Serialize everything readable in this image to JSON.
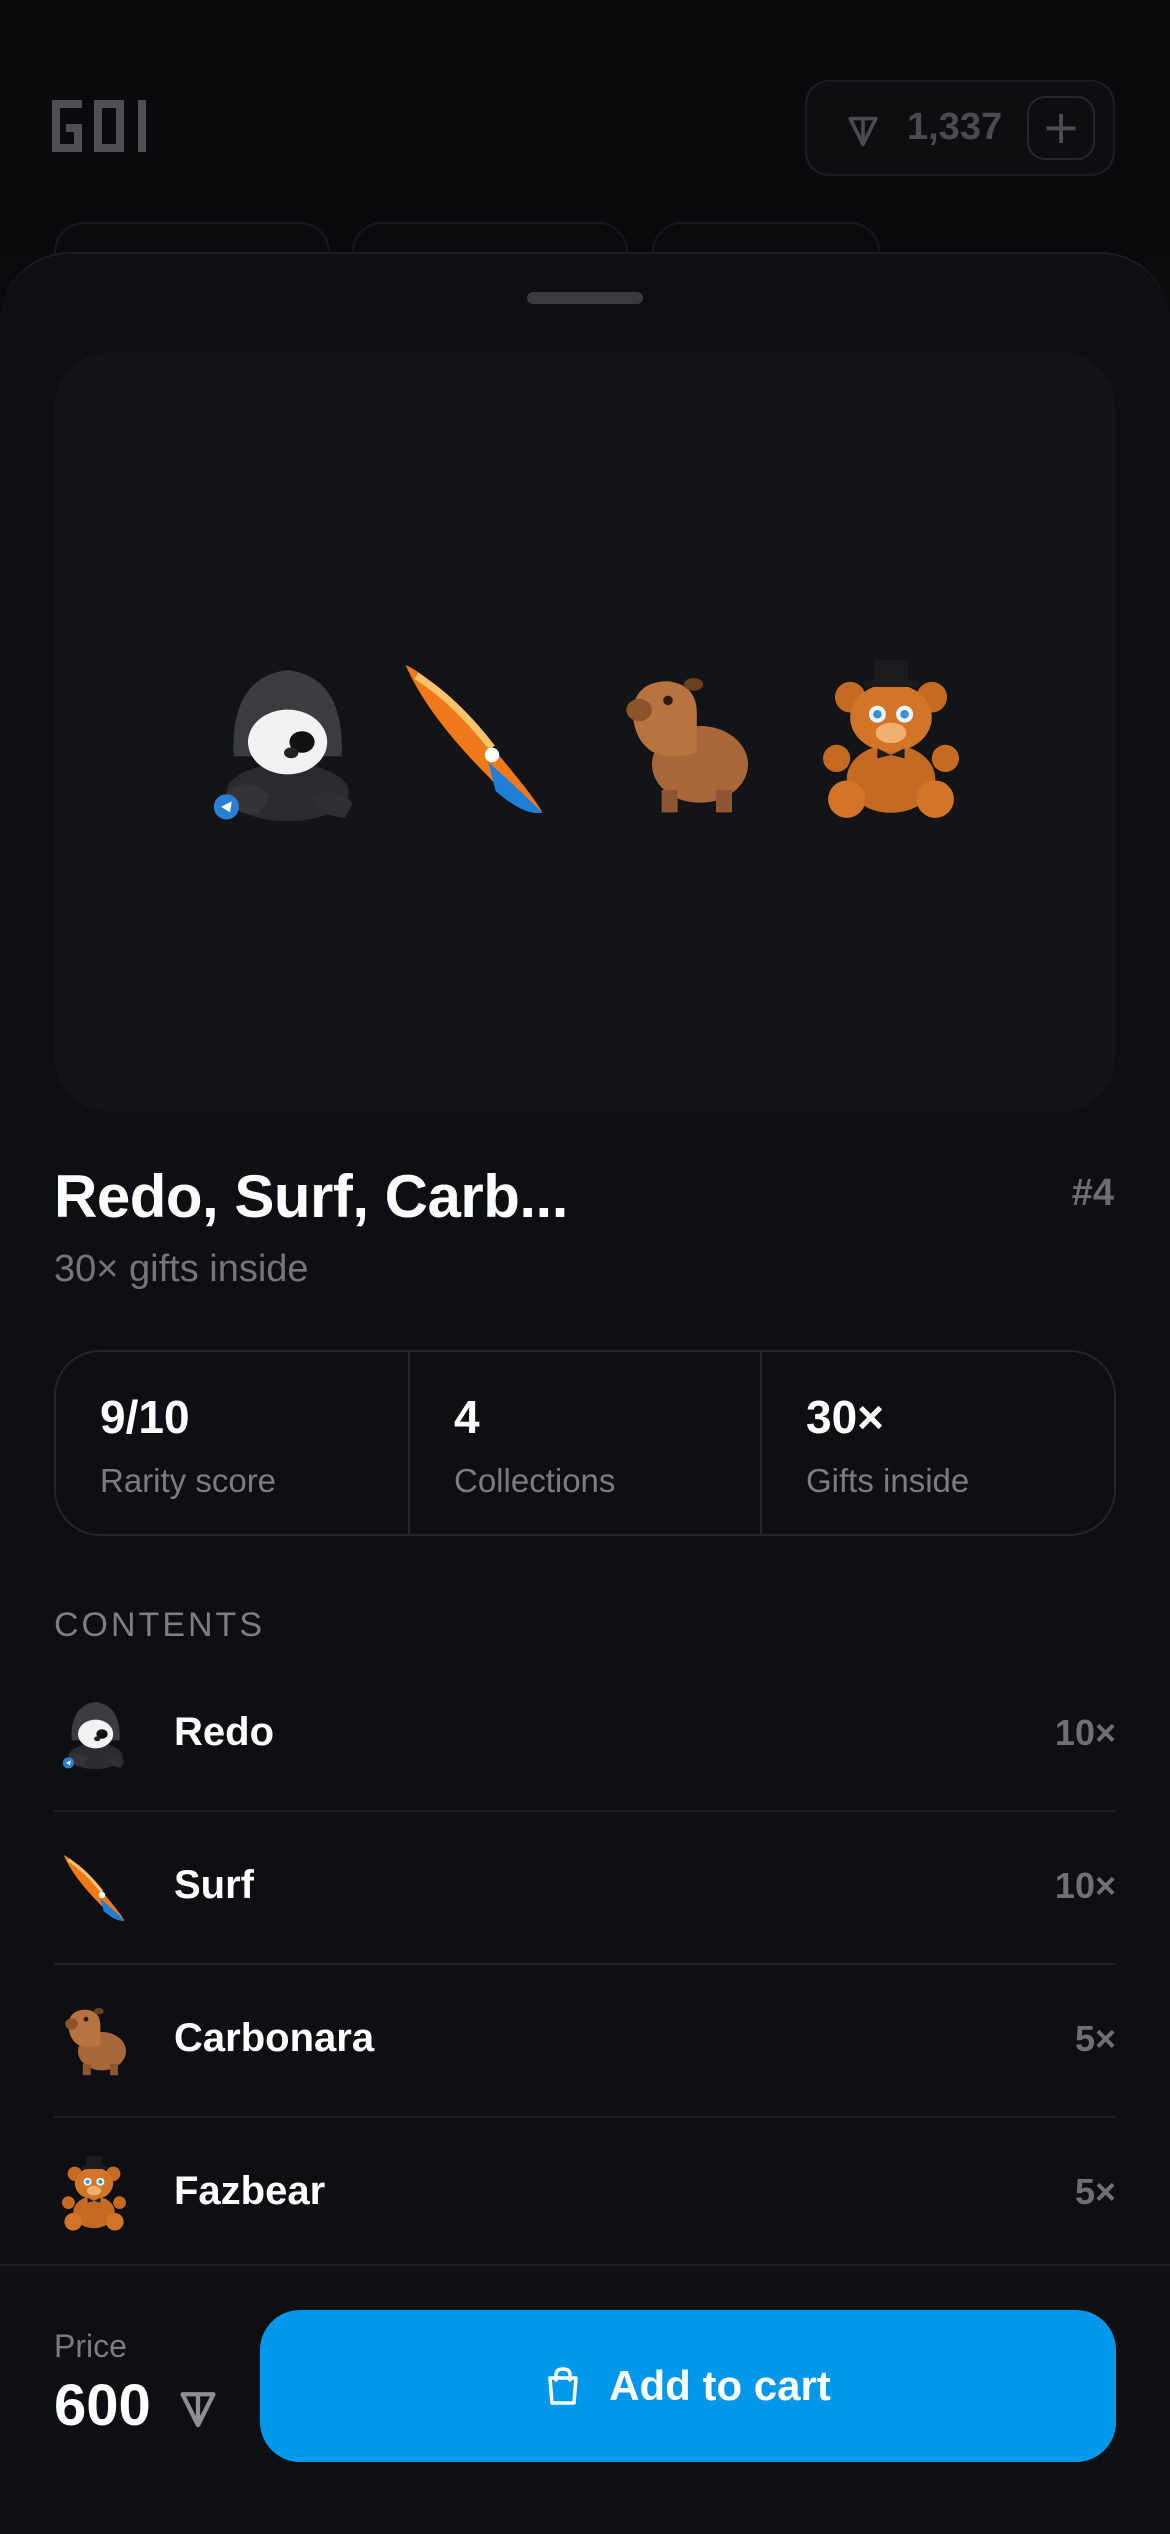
{
  "header": {
    "logo_text": "GOI",
    "balance": "1,337",
    "add_label": "+"
  },
  "pack": {
    "title": "Redo, Surf, Carb...",
    "number": "#4",
    "subtitle": "30× gifts inside"
  },
  "stats": [
    {
      "value": "9/10",
      "label": "Rarity score"
    },
    {
      "value": "4",
      "label": "Collections"
    },
    {
      "value": "30×",
      "label": "Gifts inside"
    }
  ],
  "contents": {
    "section_title": "CONTENTS",
    "items": [
      {
        "name": "Redo",
        "count": "10×",
        "icon": "hooded-panda-icon"
      },
      {
        "name": "Surf",
        "count": "10×",
        "icon": "surfboard-icon"
      },
      {
        "name": "Carbonara",
        "count": "5×",
        "icon": "capybara-icon"
      },
      {
        "name": "Fazbear",
        "count": "5×",
        "icon": "freddy-bear-icon"
      }
    ]
  },
  "footer": {
    "price_label": "Price",
    "price_value": "600",
    "cta_label": "Add to cart"
  },
  "colors": {
    "accent": "#0098ea",
    "background": "#0b0b0d",
    "sheet": "#0e0f12",
    "muted_text": "#7b7c81"
  }
}
